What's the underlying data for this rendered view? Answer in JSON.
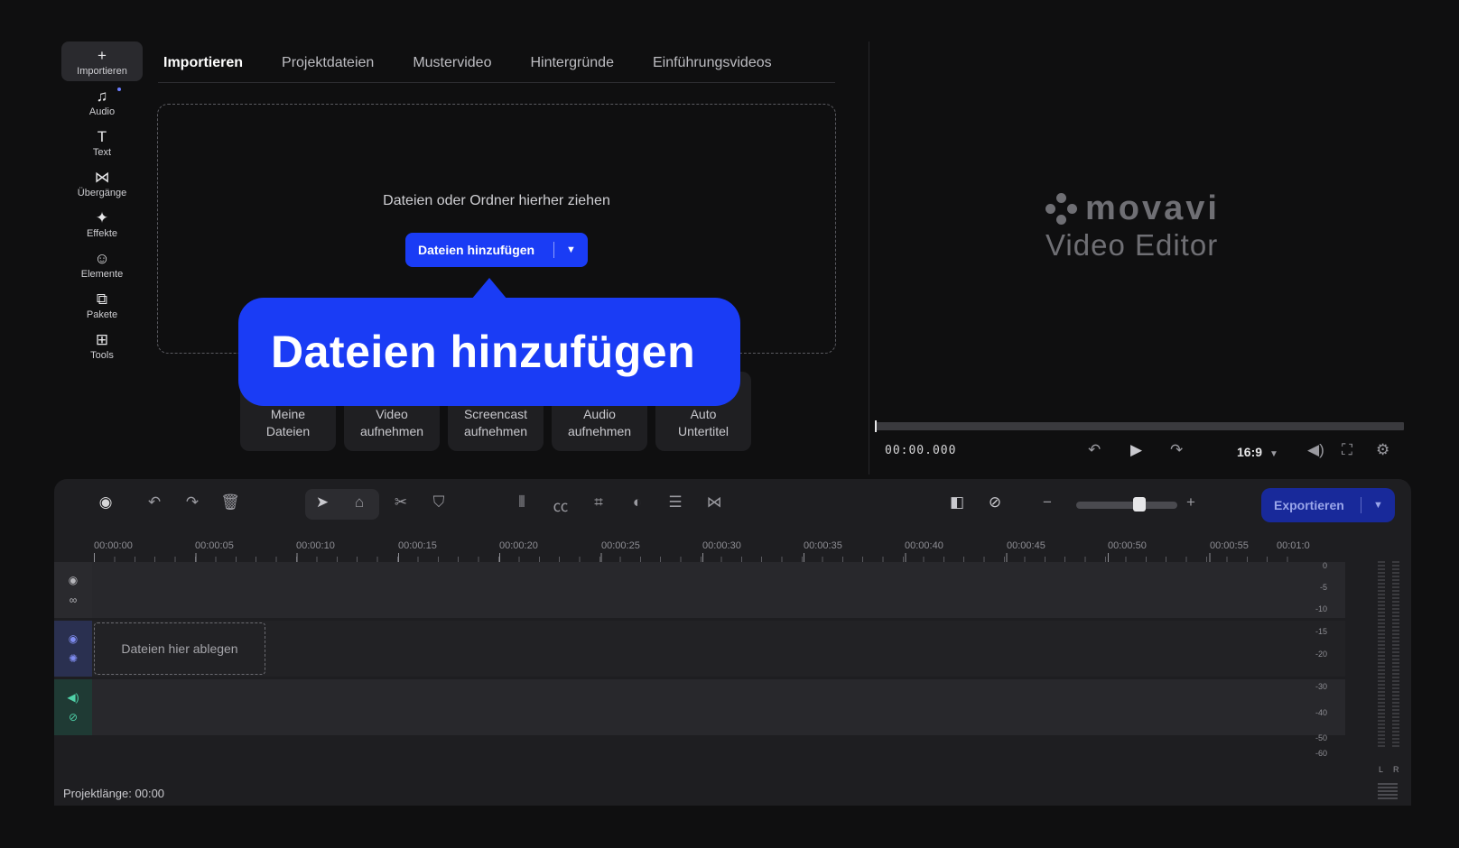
{
  "sidebar": {
    "items": [
      {
        "label": "Importieren",
        "icon": "plus-icon",
        "glyph": "+"
      },
      {
        "label": "Audio",
        "icon": "music-note-icon",
        "glyph": "♫"
      },
      {
        "label": "Text",
        "icon": "text-icon",
        "glyph": "T"
      },
      {
        "label": "Übergänge",
        "icon": "transitions-icon",
        "glyph": "⋈"
      },
      {
        "label": "Effekte",
        "icon": "effects-icon",
        "glyph": "✦"
      },
      {
        "label": "Elemente",
        "icon": "smiley-icon",
        "glyph": "☺"
      },
      {
        "label": "Pakete",
        "icon": "package-icon",
        "glyph": "⧉"
      },
      {
        "label": "Tools",
        "icon": "tools-grid-icon",
        "glyph": "⊞"
      }
    ]
  },
  "tabs": [
    "Importieren",
    "Projektdateien",
    "Mustervideo",
    "Hintergründe",
    "Einführungsvideos"
  ],
  "import": {
    "drop_text": "Dateien oder Ordner hierher ziehen",
    "add_button": "Dateien hinzufügen",
    "callout": "Dateien hinzufügen",
    "quick_buttons": [
      {
        "line1": "Meine",
        "line2": "Dateien"
      },
      {
        "line1": "Video",
        "line2": "aufnehmen"
      },
      {
        "line1": "Screencast",
        "line2": "aufnehmen"
      },
      {
        "line1": "Audio",
        "line2": "aufnehmen"
      },
      {
        "line1": "Auto",
        "line2": "Untertitel"
      }
    ]
  },
  "preview": {
    "logo_word": "movavi",
    "logo_sub": "Video Editor",
    "timecode": "00:00.000",
    "aspect": "16:9"
  },
  "timeline": {
    "export_label": "Exportieren",
    "ruler": [
      "00:00:00",
      "00:00:05",
      "00:00:10",
      "00:00:15",
      "00:00:20",
      "00:00:25",
      "00:00:30",
      "00:00:35",
      "00:00:40",
      "00:00:45",
      "00:00:50",
      "00:00:55",
      "00:01:0"
    ],
    "drop_clip": "Dateien hier ablegen",
    "meter_labels": [
      "0",
      "-5",
      "-10",
      "-15",
      "-20",
      "-30",
      "-40",
      "-50",
      "-60"
    ],
    "meter_l": "L",
    "meter_r": "R",
    "project_length": "Projektlänge: 00:00"
  },
  "colors": {
    "accent": "#1a3cf5",
    "export": "#18299a",
    "background": "#0f0f10"
  }
}
